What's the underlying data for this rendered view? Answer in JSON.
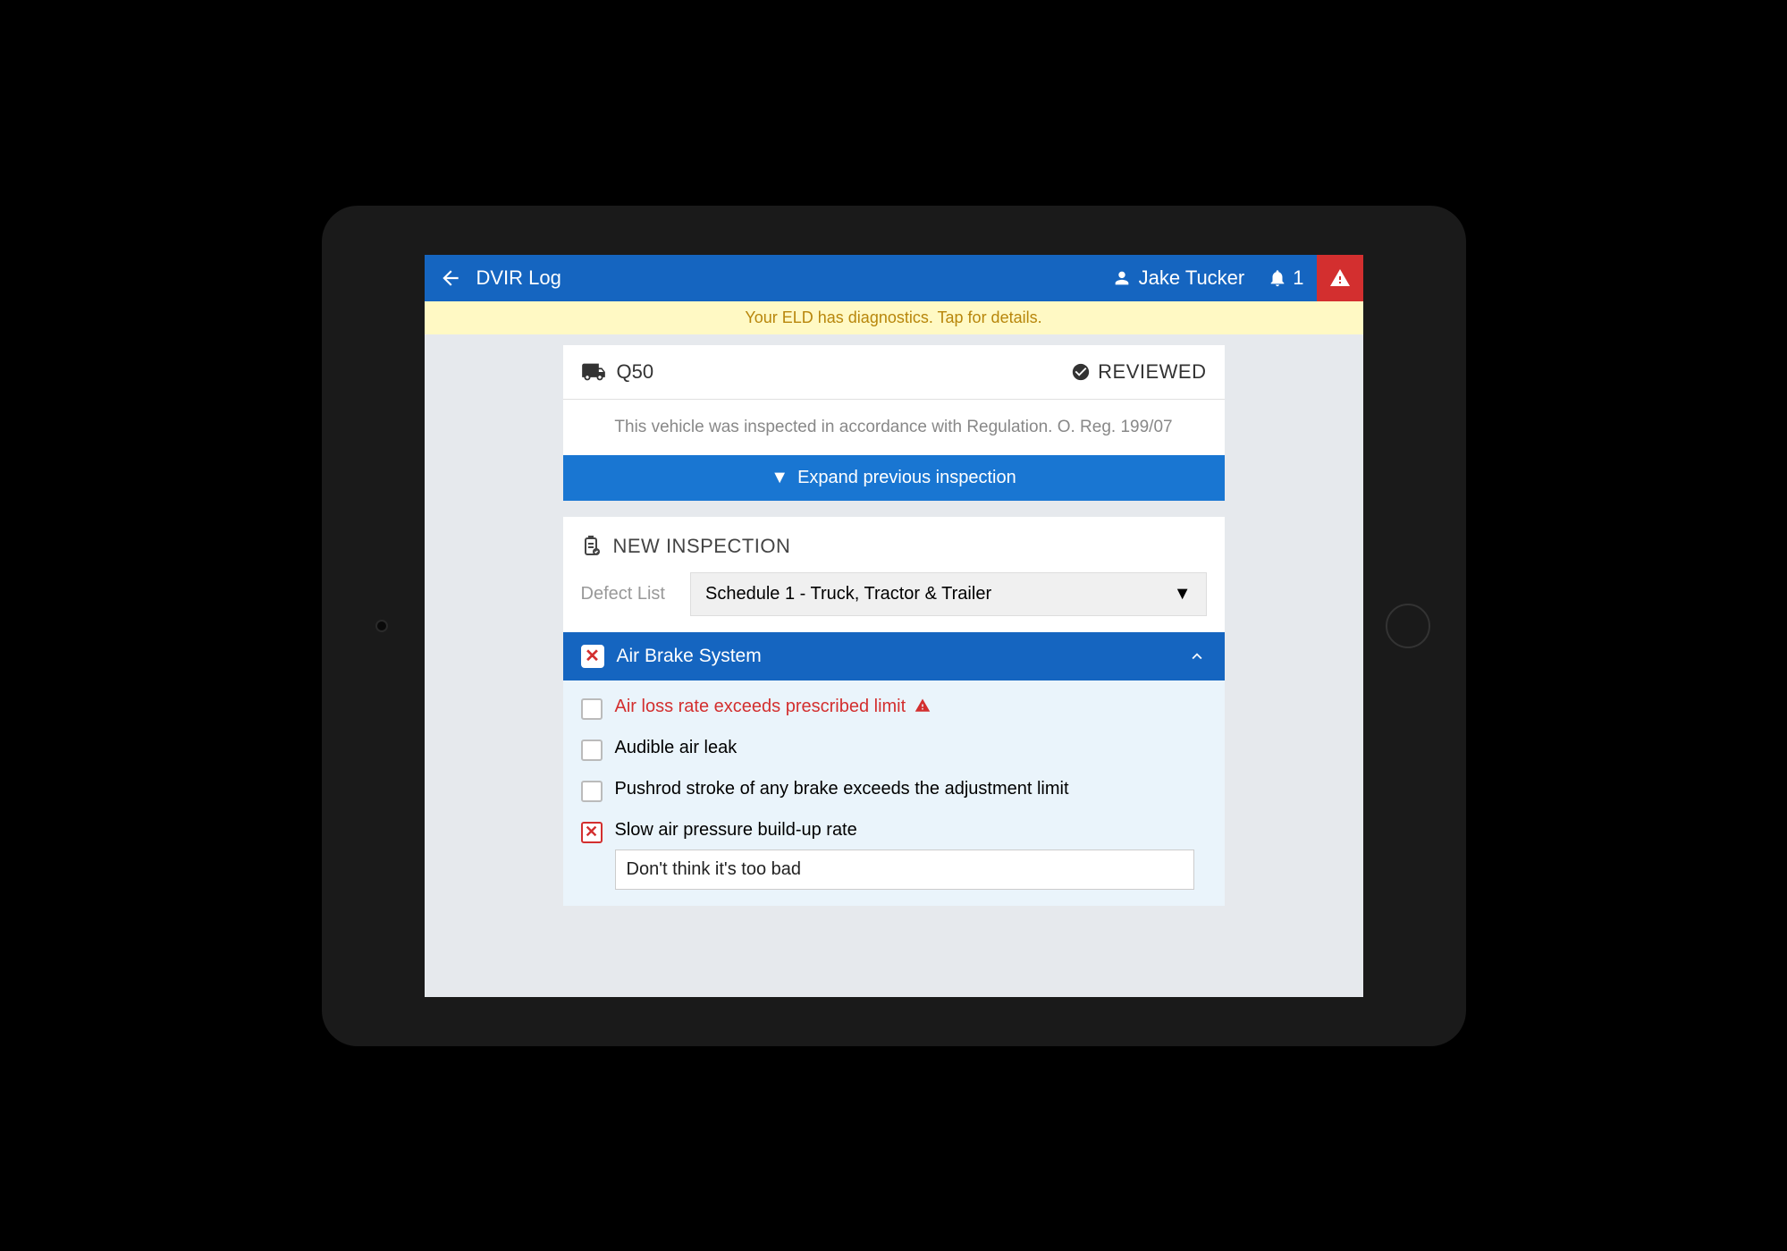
{
  "header": {
    "title": "DVIR Log",
    "user_name": "Jake Tucker",
    "notification_count": "1"
  },
  "diagnostics": {
    "message": "Your ELD has diagnostics. Tap for details."
  },
  "vehicle": {
    "name": "Q50",
    "status_label": "REVIEWED",
    "compliance_text": "This vehicle was inspected in accordance with Regulation. O. Reg. 199/07",
    "expand_label": "Expand previous inspection"
  },
  "inspection": {
    "section_title": "NEW INSPECTION",
    "defect_list_label": "Defect List",
    "defect_list_selected": "Schedule 1 - Truck, Tractor & Trailer"
  },
  "category": {
    "title": "Air Brake System",
    "items": [
      {
        "label": "Air loss rate exceeds prescribed limit",
        "major": true,
        "checked": false,
        "note": ""
      },
      {
        "label": "Audible air leak",
        "major": false,
        "checked": false,
        "note": ""
      },
      {
        "label": "Pushrod stroke of any brake exceeds the adjustment limit",
        "major": false,
        "checked": false,
        "note": ""
      },
      {
        "label": "Slow air pressure build-up rate",
        "major": false,
        "checked": true,
        "note": "Don't think it's too bad"
      }
    ]
  }
}
